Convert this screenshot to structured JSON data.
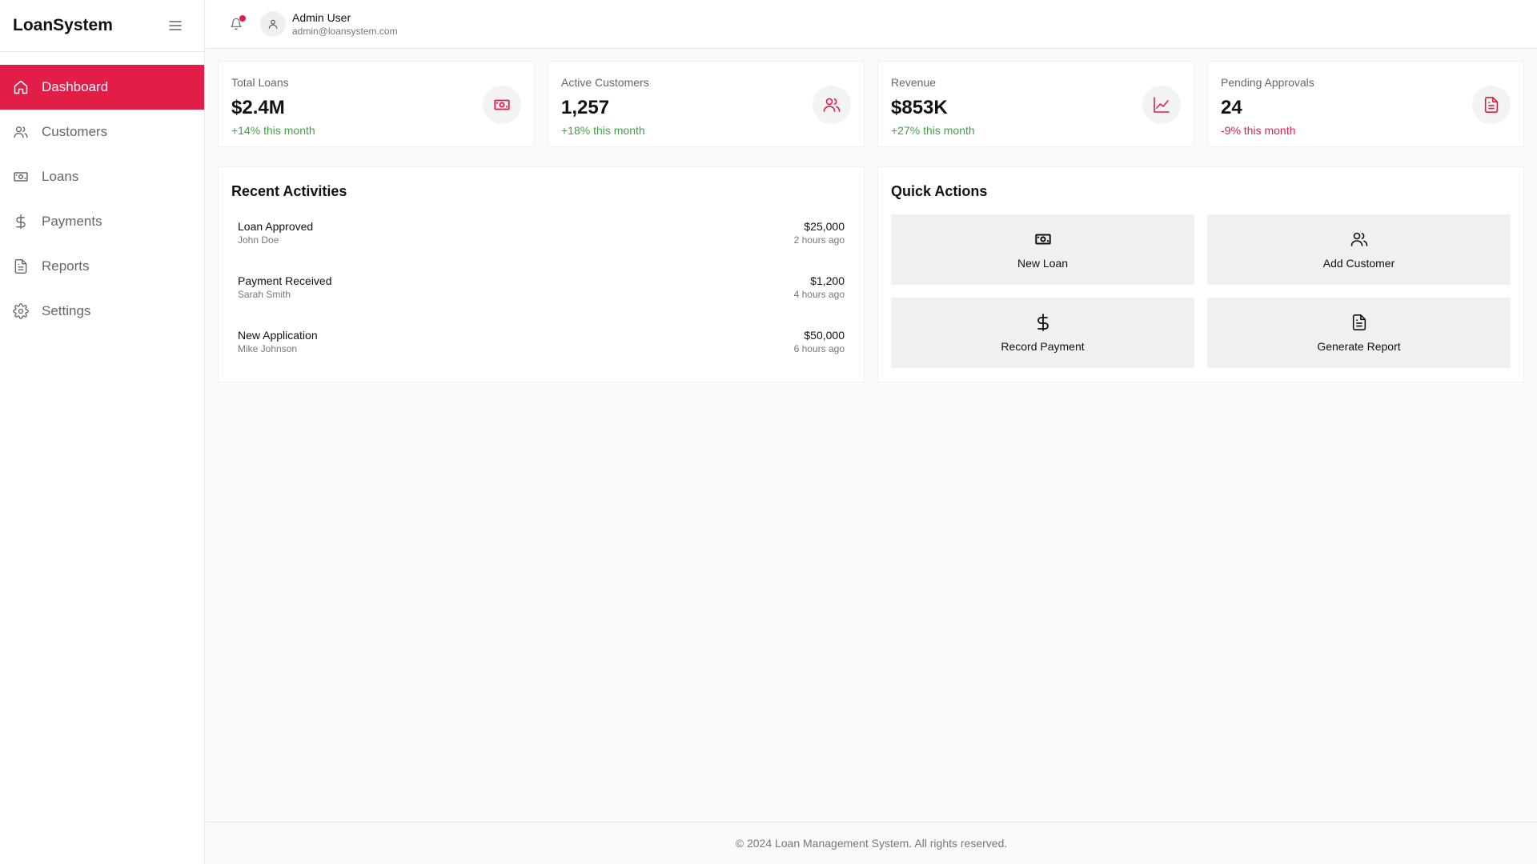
{
  "brand": {
    "name": "LoanSystem"
  },
  "colors": {
    "accent": "#e11d48",
    "positive": "#43a047",
    "negative": "#e11d48"
  },
  "sidebar": {
    "items": [
      {
        "label": "Dashboard",
        "icon": "home-icon",
        "active": true
      },
      {
        "label": "Customers",
        "icon": "users-icon",
        "active": false
      },
      {
        "label": "Loans",
        "icon": "banknote-icon",
        "active": false
      },
      {
        "label": "Payments",
        "icon": "dollar-icon",
        "active": false
      },
      {
        "label": "Reports",
        "icon": "file-text-icon",
        "active": false
      },
      {
        "label": "Settings",
        "icon": "gear-icon",
        "active": false
      }
    ]
  },
  "header": {
    "user": {
      "name": "Admin User",
      "email": "admin@loansystem.com"
    }
  },
  "stats": [
    {
      "label": "Total Loans",
      "value": "$2.4M",
      "change": "+14% this month",
      "trend": "up",
      "icon": "banknote-icon"
    },
    {
      "label": "Active Customers",
      "value": "1,257",
      "change": "+18% this month",
      "trend": "up",
      "icon": "users-icon"
    },
    {
      "label": "Revenue",
      "value": "$853K",
      "change": "+27% this month",
      "trend": "up",
      "icon": "trending-up-icon"
    },
    {
      "label": "Pending Approvals",
      "value": "24",
      "change": "-9% this month",
      "trend": "down",
      "icon": "file-text-icon"
    }
  ],
  "activities": {
    "title": "Recent Activities",
    "items": [
      {
        "title": "Loan Approved",
        "person": "John Doe",
        "amount": "$25,000",
        "time": "2 hours ago"
      },
      {
        "title": "Payment Received",
        "person": "Sarah Smith",
        "amount": "$1,200",
        "time": "4 hours ago"
      },
      {
        "title": "New Application",
        "person": "Mike Johnson",
        "amount": "$50,000",
        "time": "6 hours ago"
      }
    ]
  },
  "quick_actions": {
    "title": "Quick Actions",
    "items": [
      {
        "label": "New Loan",
        "icon": "banknote-icon"
      },
      {
        "label": "Add Customer",
        "icon": "users-icon"
      },
      {
        "label": "Record Payment",
        "icon": "dollar-icon"
      },
      {
        "label": "Generate Report",
        "icon": "file-text-icon"
      }
    ]
  },
  "footer": {
    "text": "© 2024 Loan Management System. All rights reserved."
  }
}
